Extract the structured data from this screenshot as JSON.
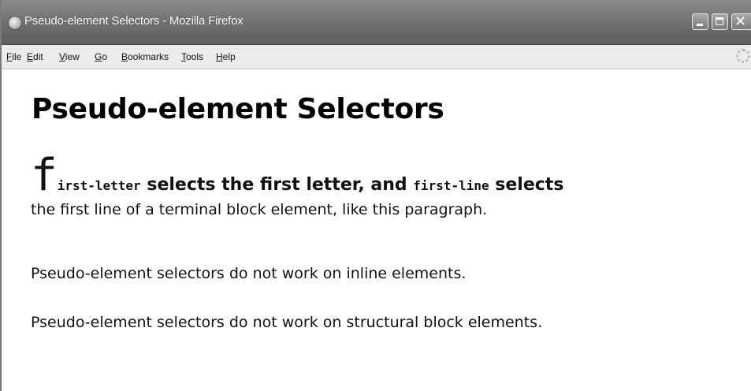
{
  "window": {
    "title": "Pseudo-element Selectors - Mozilla Firefox"
  },
  "menu": {
    "items": [
      {
        "label": "File",
        "accel": "F",
        "rest": "ile"
      },
      {
        "label": "Edit",
        "accel": "E",
        "rest": "dit"
      },
      {
        "label": "View",
        "accel": "V",
        "rest": "iew"
      },
      {
        "label": "Go",
        "accel": "G",
        "rest": "o"
      },
      {
        "label": "Bookmarks",
        "accel": "B",
        "rest": "ookmarks"
      },
      {
        "label": "Tools",
        "accel": "T",
        "rest": "ools"
      },
      {
        "label": "Help",
        "accel": "H",
        "rest": "elp"
      }
    ]
  },
  "page": {
    "heading": "Pseudo-element Selectors",
    "para1": {
      "drop_letter": "f",
      "code1_rest": "irst-letter",
      "text1": " selects the first letter, and ",
      "code2": "first-line",
      "text2": " selects",
      "line2": "the first line of a terminal block element, like this paragraph."
    },
    "para2": "Pseudo-element selectors do not work on inline elements.",
    "para3": "Pseudo-element selectors do not work on structural block elements."
  },
  "icons": {
    "app": "firefox-icon",
    "throbber": "throbber-icon",
    "minimize": "minimize-icon",
    "maximize": "maximize-icon",
    "close": "close-icon"
  },
  "colors": {
    "titlebar": "#7a7a7a",
    "menubar": "#ececec",
    "content_bg": "#ffffff",
    "text": "#111111"
  }
}
